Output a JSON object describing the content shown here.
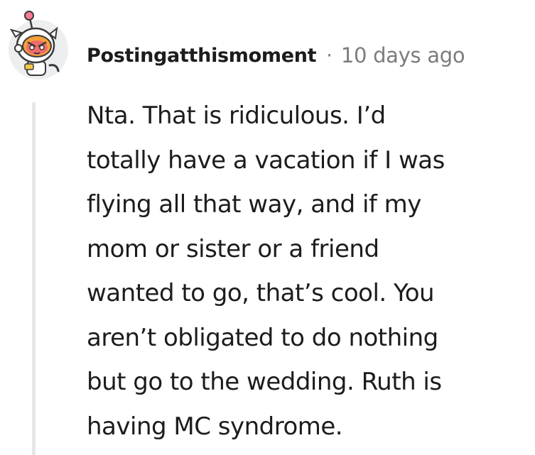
{
  "comment": {
    "author": "Postingatthismoment",
    "separator": "·",
    "timestamp": "10 days ago",
    "avatar_icon": "robot-cat-astronaut-avatar",
    "body_lines": [
      "Nta. That is ridiculous. I’d",
      "totally have a vacation if I was",
      "flying all that way, and if my",
      "mom or sister or a friend",
      "wanted to go, that’s cool. You",
      "aren’t obligated to do nothing",
      "but go to the wedding. Ruth is",
      "having MC syndrome."
    ]
  },
  "colors": {
    "author_text": "#1c1c1c",
    "meta_text": "#7c7c7c",
    "thread_line": "#e6e6e6",
    "avatar_accent": "#f26b6b"
  }
}
